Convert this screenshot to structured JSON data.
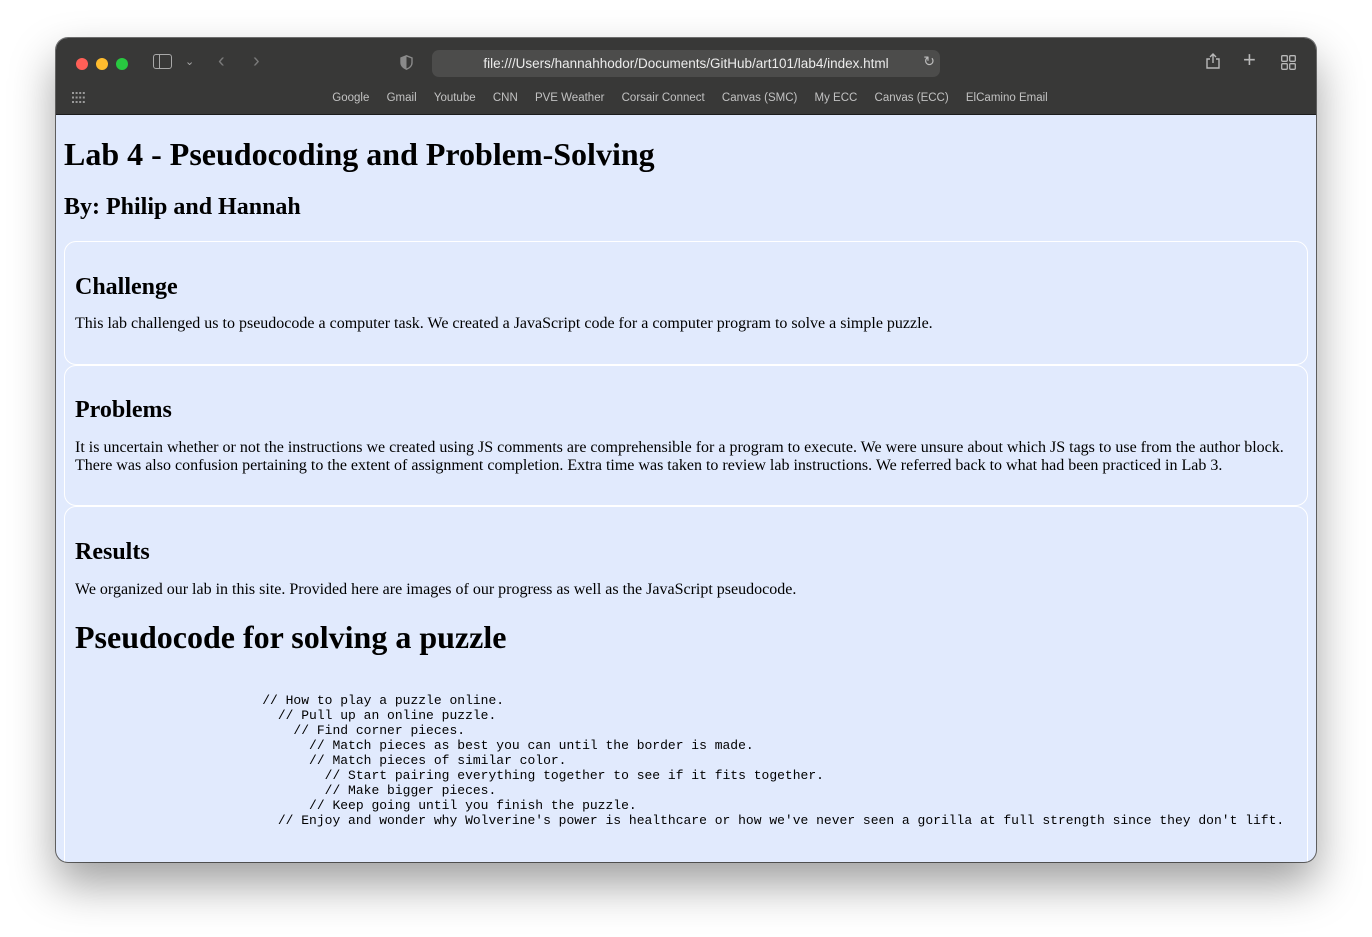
{
  "browser": {
    "url": "file:///Users/hannahhodor/Documents/GitHub/art101/lab4/index.html",
    "bookmarks": [
      "Google",
      "Gmail",
      "Youtube",
      "CNN",
      "PVE Weather",
      "Corsair Connect",
      "Canvas (SMC)",
      "My ECC",
      "Canvas (ECC)",
      "ElCamino Email"
    ]
  },
  "page": {
    "title": "Lab 4 - Pseudocoding and Problem-Solving",
    "byline": "By: Philip and Hannah",
    "sections": [
      {
        "heading": "Challenge",
        "body": "This lab challenged us to pseudocode a computer task. We created a JavaScript code for a computer program to solve a simple puzzle."
      },
      {
        "heading": "Problems",
        "body": "It is uncertain whether or not the instructions we created using JS comments are comprehensible for a program to execute. We were unsure about which JS tags to use from the author block. There was also confusion pertaining to the extent of assignment completion. Extra time was taken to review lab instructions. We referred back to what had been practiced in Lab 3."
      },
      {
        "heading": "Results",
        "body": "We organized our lab in this site. Provided here are images of our progress as well as the JavaScript pseudocode."
      }
    ],
    "code_heading": "Pseudocode for solving a puzzle",
    "code": "                        // How to play a puzzle online.\n                          // Pull up an online puzzle.\n                            // Find corner pieces.\n                              // Match pieces as best you can until the border is made.\n                              // Match pieces of similar color.\n                                // Start pairing everything together to see if it fits together.\n                                // Make bigger pieces.\n                              // Keep going until you finish the puzzle.\n                          // Enjoy and wonder why Wolverine's power is healthcare or how we've never seen a gorilla at full strength since they don't lift."
  },
  "icons": [
    "sidebar-icon",
    "chevron-down-icon",
    "back-arrow-icon",
    "forward-arrow-icon",
    "privacy-shield-icon",
    "reload-icon",
    "share-icon",
    "new-tab-plus-icon",
    "tab-overview-grid-icon",
    "apps-grid-icon"
  ],
  "colors": {
    "chrome": "#383837",
    "page_background": "#e1eafd",
    "url_bar": "#4c4c4b"
  }
}
